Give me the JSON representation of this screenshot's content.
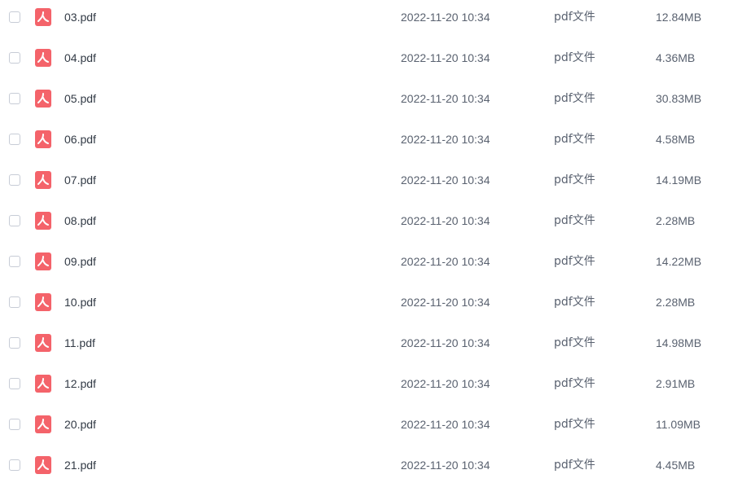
{
  "file_list": {
    "colors": {
      "icon": "#f4636a",
      "text": "#323a45",
      "meta_text": "#5a6270",
      "checkbox_border": "#c7ccd6"
    },
    "icon_name": "pdf-file-icon",
    "rows": [
      {
        "name": "03.pdf",
        "modified": "2022-11-20 10:34",
        "type": "pdf文件",
        "size": "12.84MB"
      },
      {
        "name": "04.pdf",
        "modified": "2022-11-20 10:34",
        "type": "pdf文件",
        "size": "4.36MB"
      },
      {
        "name": "05.pdf",
        "modified": "2022-11-20 10:34",
        "type": "pdf文件",
        "size": "30.83MB"
      },
      {
        "name": "06.pdf",
        "modified": "2022-11-20 10:34",
        "type": "pdf文件",
        "size": "4.58MB"
      },
      {
        "name": "07.pdf",
        "modified": "2022-11-20 10:34",
        "type": "pdf文件",
        "size": "14.19MB"
      },
      {
        "name": "08.pdf",
        "modified": "2022-11-20 10:34",
        "type": "pdf文件",
        "size": "2.28MB"
      },
      {
        "name": "09.pdf",
        "modified": "2022-11-20 10:34",
        "type": "pdf文件",
        "size": "14.22MB"
      },
      {
        "name": "10.pdf",
        "modified": "2022-11-20 10:34",
        "type": "pdf文件",
        "size": "2.28MB"
      },
      {
        "name": "11.pdf",
        "modified": "2022-11-20 10:34",
        "type": "pdf文件",
        "size": "14.98MB"
      },
      {
        "name": "12.pdf",
        "modified": "2022-11-20 10:34",
        "type": "pdf文件",
        "size": "2.91MB"
      },
      {
        "name": "20.pdf",
        "modified": "2022-11-20 10:34",
        "type": "pdf文件",
        "size": "11.09MB"
      },
      {
        "name": "21.pdf",
        "modified": "2022-11-20 10:34",
        "type": "pdf文件",
        "size": "4.45MB"
      }
    ]
  }
}
